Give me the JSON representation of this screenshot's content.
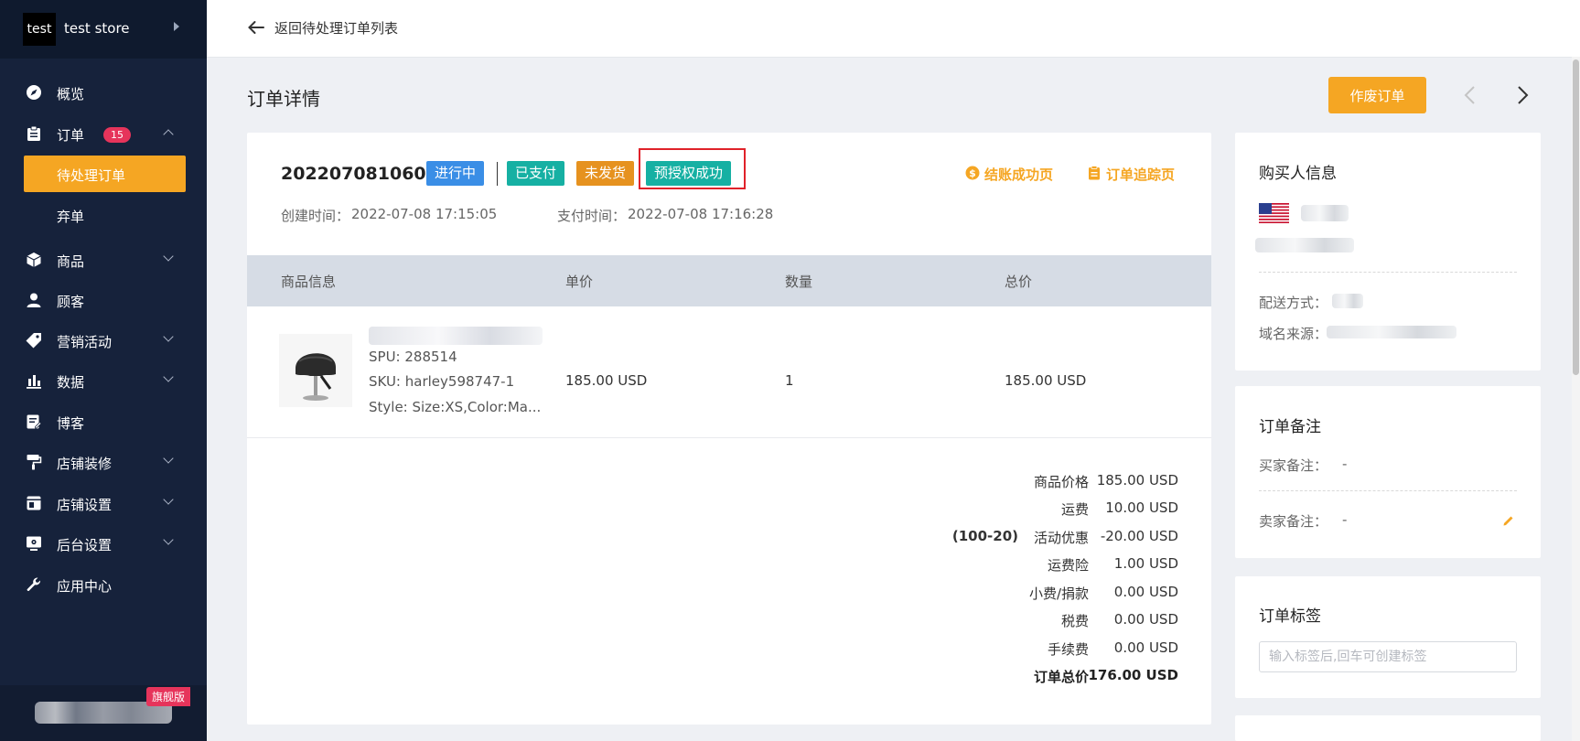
{
  "sidebar": {
    "store_logo_text": "test",
    "store_name": "test store",
    "items": [
      {
        "label": "概览"
      },
      {
        "label": "订单",
        "badge": "15"
      },
      {
        "label": "商品"
      },
      {
        "label": "顾客"
      },
      {
        "label": "营销活动"
      },
      {
        "label": "数据"
      },
      {
        "label": "博客"
      },
      {
        "label": "店铺装修"
      },
      {
        "label": "店铺设置"
      },
      {
        "label": "后台设置"
      },
      {
        "label": "应用中心"
      }
    ],
    "sub_items": [
      {
        "label": "待处理订单",
        "active": true
      },
      {
        "label": "弃单"
      }
    ],
    "edition_tag": "旗舰版"
  },
  "topbar": {
    "back_label": "返回待处理订单列表"
  },
  "page": {
    "title": "订单详情",
    "void_button": "作废订单"
  },
  "order": {
    "number": "2022070810607",
    "tags": [
      "进行中",
      "已支付",
      "未发货",
      "预授权成功"
    ],
    "links": {
      "checkout_success": "结账成功页",
      "tracking": "订单追踪页"
    },
    "created_label": "创建时间：",
    "created": "2022-07-08 17:15:05",
    "paid_label": "支付时间：",
    "paid": "2022-07-08 17:16:28"
  },
  "table": {
    "headers": [
      "商品信息",
      "单价",
      "数量",
      "总价"
    ],
    "item": {
      "spu": "SPU: 288514",
      "sku": "SKU: harley598747-1",
      "style": "Style: Size:XS,Color:Ma...",
      "unit_price": "185.00 USD",
      "quantity": "1",
      "total": "185.00 USD"
    }
  },
  "summary": {
    "promo_code": "(100-20)",
    "rows": [
      {
        "label": "商品价格",
        "value": "185.00 USD"
      },
      {
        "label": "运费",
        "value": "10.00 USD"
      },
      {
        "label": "活动优惠",
        "value": "-20.00 USD"
      },
      {
        "label": "运费险",
        "value": "1.00 USD"
      },
      {
        "label": "小费/捐款",
        "value": "0.00 USD"
      },
      {
        "label": "税费",
        "value": "0.00 USD"
      },
      {
        "label": "手续费",
        "value": "0.00 USD"
      },
      {
        "label": "订单总价",
        "value": "176.00 USD"
      }
    ]
  },
  "buyer": {
    "title": "购买人信息",
    "shipping_label": "配送方式：",
    "domain_label": "域名来源："
  },
  "notes": {
    "title": "订单备注",
    "buyer_label": "买家备注：",
    "buyer_value": "-",
    "seller_label": "卖家备注：",
    "seller_value": "-"
  },
  "tags_card": {
    "title": "订单标签",
    "placeholder": "输入标签后,回车可创建标签"
  },
  "colors": {
    "accent": "#f5a623",
    "sidebar": "#16223b",
    "danger": "#e0222a"
  }
}
